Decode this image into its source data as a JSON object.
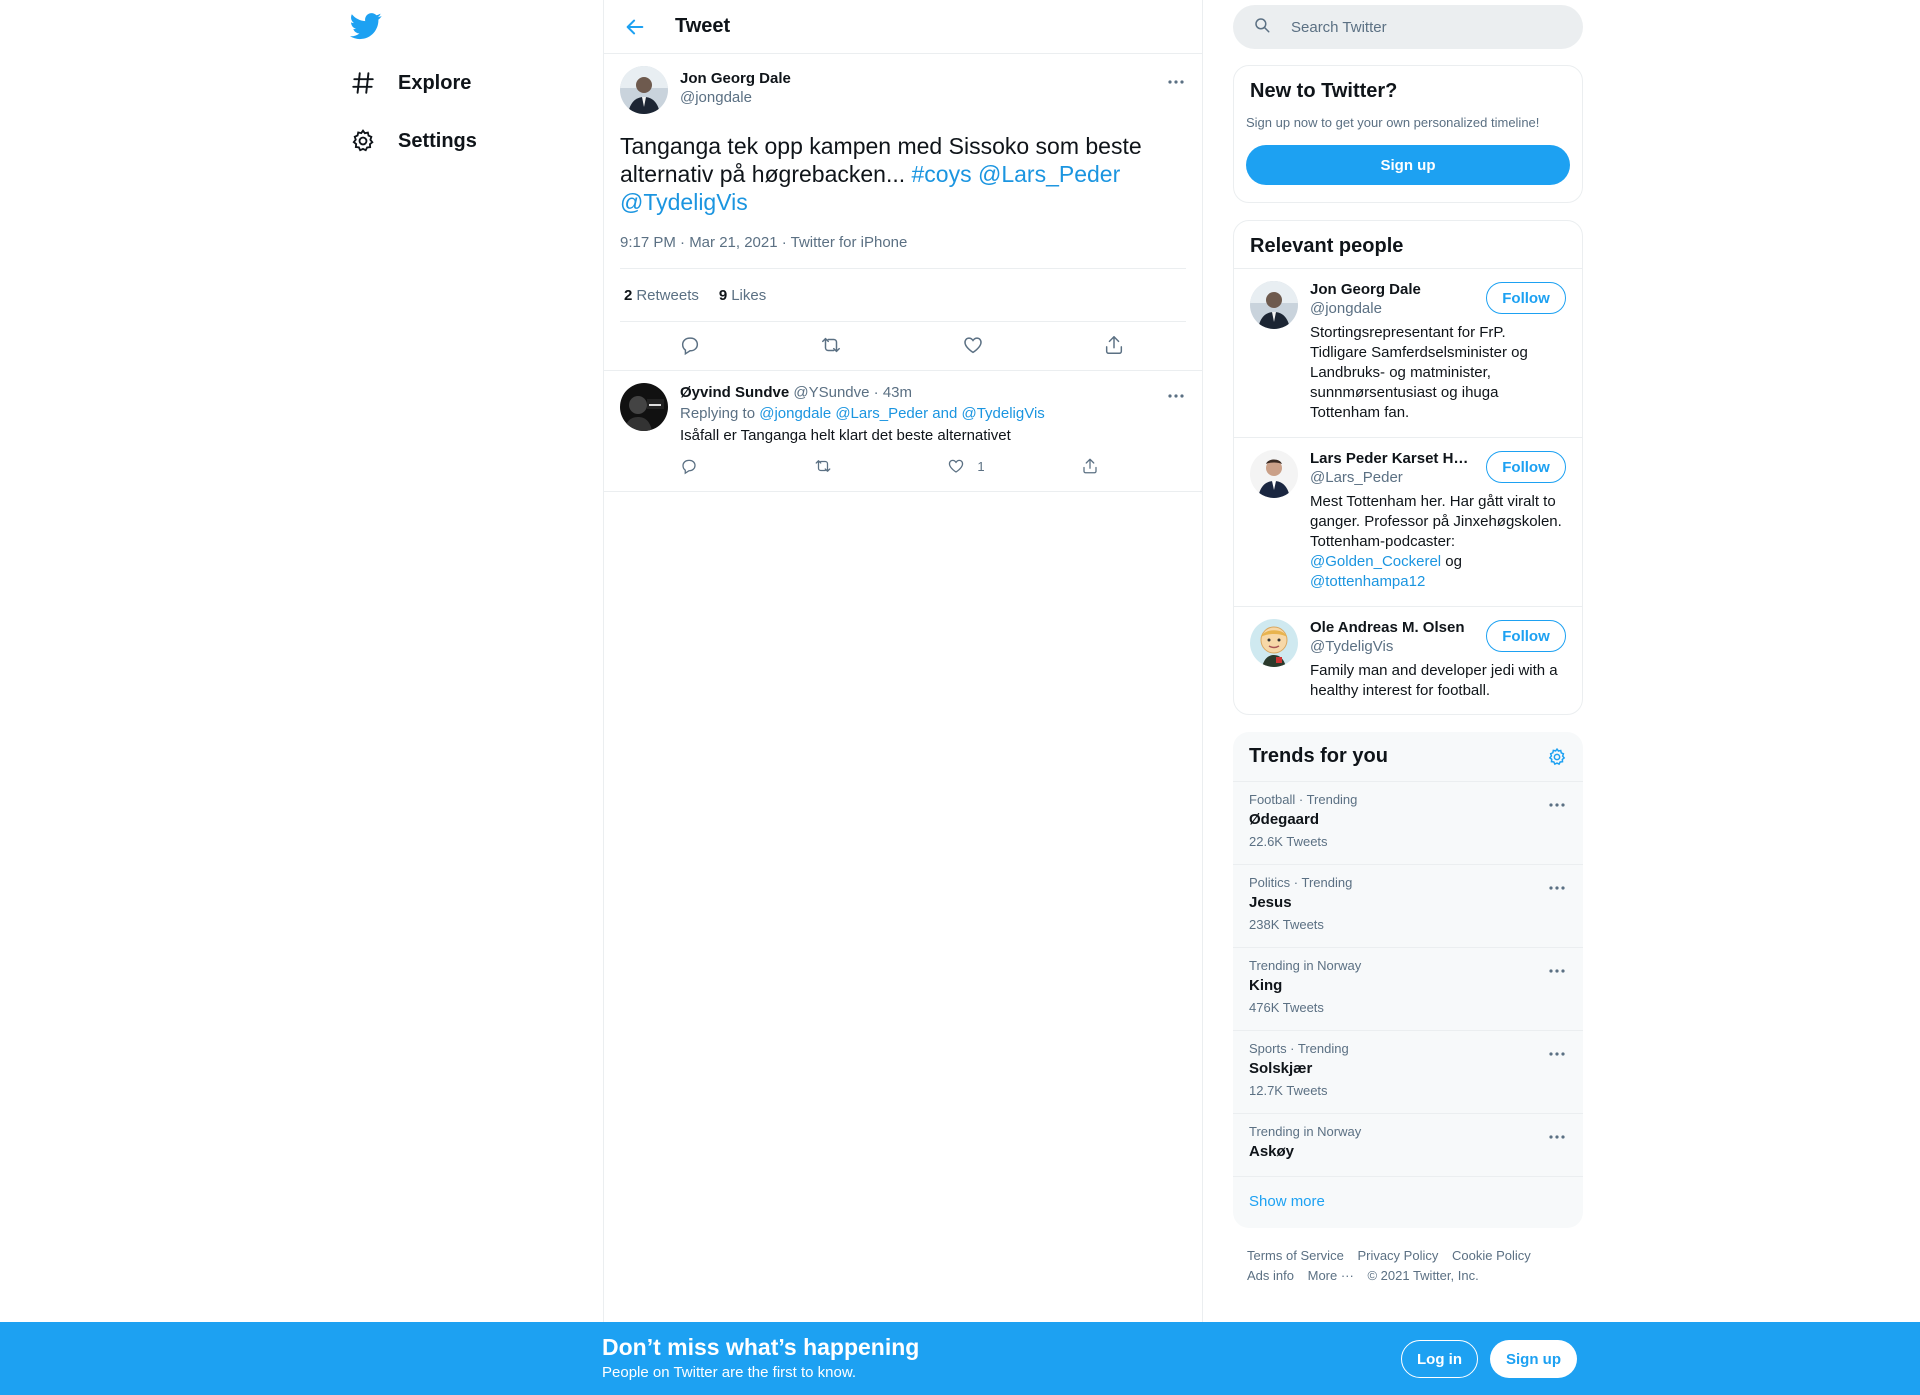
{
  "nav": {
    "logo_icon": "twitter-bird-icon",
    "items": [
      {
        "label": "Explore",
        "icon": "hashtag-icon"
      },
      {
        "label": "Settings",
        "icon": "gear-icon"
      }
    ]
  },
  "header": {
    "title": "Tweet",
    "back_icon": "arrow-left-icon"
  },
  "tweet": {
    "author_name": "Jon Georg Dale",
    "author_handle": "@jongdale",
    "text_plain": "Tanganga tek opp kampen med Sissoko som beste alternativ på høgrebacken... ",
    "hashtag": "#coys",
    "mention1": "@Lars_Peder",
    "mention2": "@TydeligVis",
    "meta": "9:17 PM · Mar 21, 2021 · Twitter for iPhone",
    "retweets_count": "2",
    "retweets_label": "Retweets",
    "likes_count": "9",
    "likes_label": "Likes"
  },
  "reply": {
    "name": "Øyvind Sundve",
    "handle": "@YSundve",
    "sep": "·",
    "time": "43m",
    "replying_prefix": "Replying to ",
    "replying_to": "@jongdale @Lars_Peder and @TydeligVis",
    "text": "Isåfall er Tanganga helt klart det beste alternativet",
    "like_count": "1"
  },
  "search": {
    "placeholder": "Search Twitter"
  },
  "new_to_twitter": {
    "title": "New to Twitter?",
    "subtitle": "Sign up now to get your own personalized timeline!",
    "button": "Sign up"
  },
  "relevant": {
    "title": "Relevant people",
    "follow_label": "Follow",
    "people": [
      {
        "name": "Jon Georg Dale",
        "handle": "@jongdale",
        "bio": "Stortingsrepresentant for FrP. Tidligare Samferdselsminister og Landbruks- og matminister, sunnmørsentusiast og ihuga Tottenham fan."
      },
      {
        "name": "Lars Peder Karset H…",
        "handle": "@Lars_Peder",
        "bio": "Mest Tottenham her. Har gått viralt to ganger. Professor på Jinxehøgskolen. Tottenham-podcaster: ",
        "bio_link1": "@Golden_Cockerel",
        "bio_mid": " og ",
        "bio_link2": "@tottenhampa12"
      },
      {
        "name": "Ole Andreas M. Olsen",
        "handle": "@TydeligVis",
        "bio": "Family man and developer jedi with a healthy interest for football."
      }
    ]
  },
  "trends": {
    "title": "Trends for you",
    "items": [
      {
        "meta": "Football · Trending",
        "name": "Ødegaard",
        "count": "22.6K Tweets"
      },
      {
        "meta": "Politics · Trending",
        "name": "Jesus",
        "count": "238K Tweets"
      },
      {
        "meta": "Trending in Norway",
        "name": "King",
        "count": "476K Tweets"
      },
      {
        "meta": "Sports · Trending",
        "name": "Solskjær",
        "count": "12.7K Tweets"
      },
      {
        "meta": "Trending in Norway",
        "name": "Askøy",
        "count": ""
      }
    ],
    "show_more": "Show more"
  },
  "footer": {
    "terms": "Terms of Service",
    "privacy": "Privacy Policy",
    "cookie": "Cookie Policy",
    "ads": "Ads info",
    "more": "More ···",
    "copyright": "© 2021 Twitter, Inc."
  },
  "bottom_bar": {
    "title": "Don’t miss what’s happening",
    "subtitle": "People on Twitter are the first to know.",
    "login": "Log in",
    "signup": "Sign up"
  },
  "colors": {
    "accent": "#1da1f2",
    "link": "#1b95e0",
    "muted": "#5b7083",
    "border": "#ebeef0"
  }
}
